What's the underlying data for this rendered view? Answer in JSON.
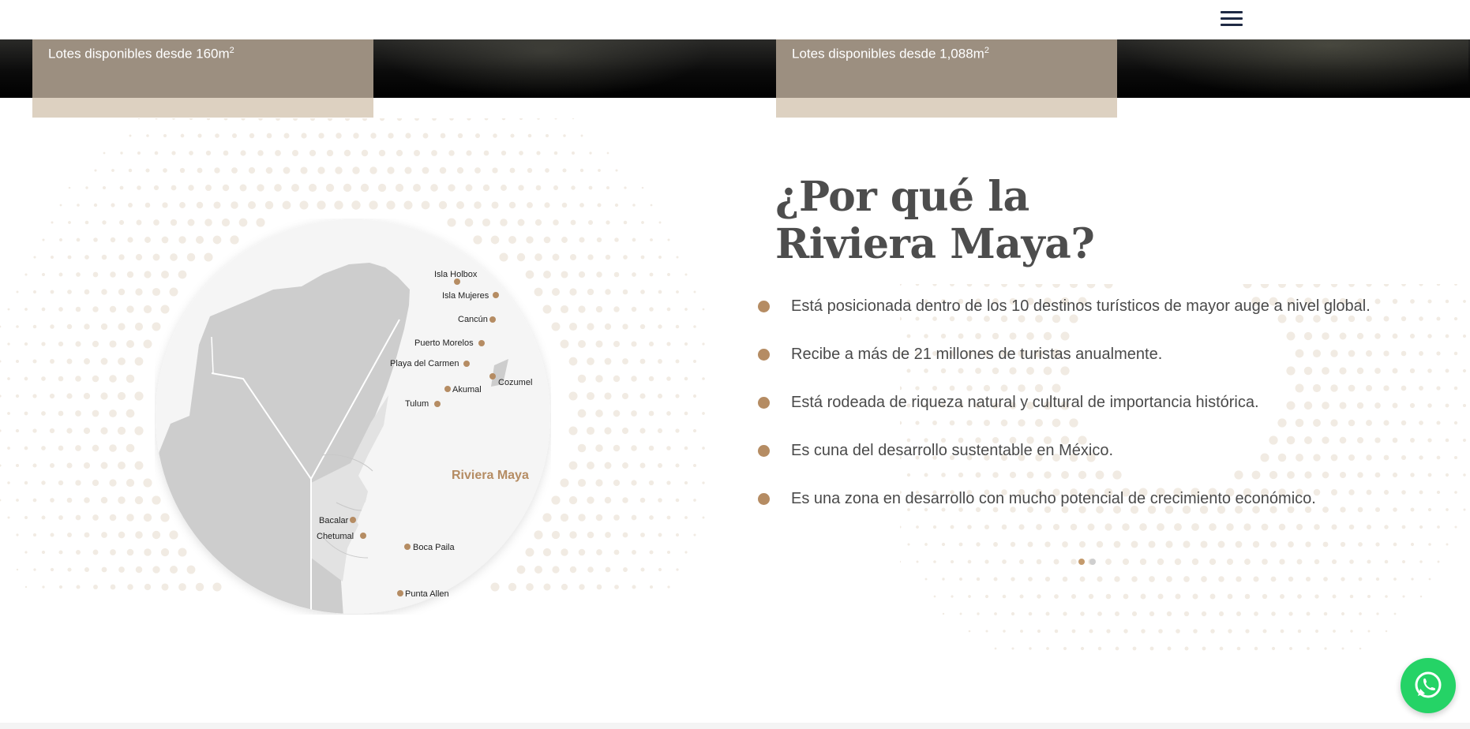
{
  "header": {
    "menu_icon": "hamburger-menu-icon",
    "accent_color": "#1f2a44"
  },
  "lots": [
    {
      "label": "Lotes disponibles desde 160m",
      "superscript": "2"
    },
    {
      "label": "Lotes disponibles desde 1,088m",
      "superscript": "2"
    }
  ],
  "map": {
    "highlight_label": "Riviera Maya",
    "places": [
      "Isla Holbox",
      "Isla Mujeres",
      "Cancún",
      "Puerto Morelos",
      "Playa del Carmen",
      "Cozumel",
      "Akumal",
      "Tulum",
      "Bacalar",
      "Chetumal",
      "Boca Paila",
      "Punta Allen"
    ],
    "marker_color": "#b58c63"
  },
  "why": {
    "title_line1": "¿Por qué la",
    "title_line2": "Riviera Maya?",
    "bullets": [
      "Está posicionada dentro de los 10 destinos turísticos de mayor auge a nivel global.",
      "Recibe a más de 21 millones de turistas anualmente.",
      "Está rodeada de riqueza natural y cultural de importancia histórica.",
      "Es cuna del desarrollo sustentable en México.",
      "Es una zona en desarrollo con mucho potencial de crecimiento económico."
    ],
    "bullet_color": "#b58c63"
  },
  "carousel": {
    "page_count": 2,
    "active_page": 1
  },
  "whatsapp": {
    "icon": "whatsapp-icon",
    "color": "#25d366"
  }
}
